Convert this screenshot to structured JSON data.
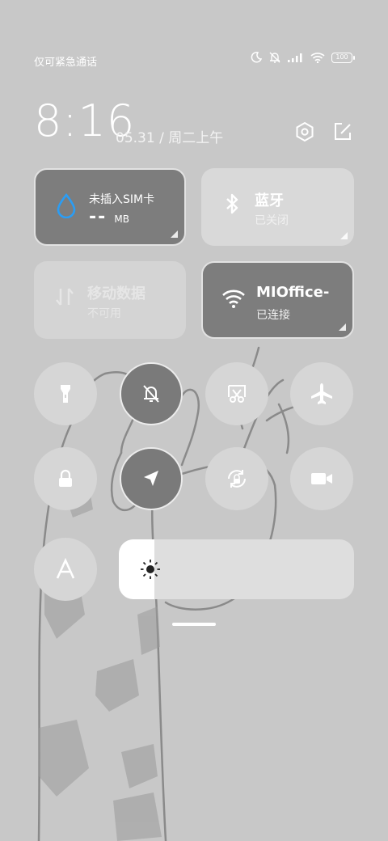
{
  "status_bar": {
    "left_text": "仅可紧急通话",
    "battery": "100",
    "icons": [
      "moon-icon",
      "silent-icon",
      "signal-icon",
      "wifi-icon",
      "battery-icon"
    ]
  },
  "header": {
    "time": "8:16",
    "date": "05.31 / 周二上午",
    "icons": [
      "settings-icon",
      "edit-icon"
    ]
  },
  "tiles": [
    {
      "id": "sim",
      "icon": "water-drop-icon",
      "title": "未插入SIM卡",
      "value": "--",
      "unit": "MB",
      "state": "active"
    },
    {
      "id": "bluetooth",
      "icon": "bluetooth-icon",
      "title": "蓝牙",
      "sub": "已关闭",
      "state": "off"
    },
    {
      "id": "mobile-data",
      "icon": "data-arrows-icon",
      "title": "移动数据",
      "sub": "不可用",
      "state": "disabled"
    },
    {
      "id": "wifi",
      "icon": "wifi-icon",
      "title": "MIOffice-",
      "sub": "已连接",
      "state": "active"
    }
  ],
  "toggles": [
    {
      "icon": "flashlight-icon",
      "state": "off"
    },
    {
      "icon": "mute-bell-icon",
      "state": "on"
    },
    {
      "icon": "screenshot-icon",
      "state": "off"
    },
    {
      "icon": "airplane-icon",
      "state": "off"
    },
    {
      "icon": "lock-icon",
      "state": "off"
    },
    {
      "icon": "location-icon",
      "state": "on"
    },
    {
      "icon": "rotation-lock-icon",
      "state": "off"
    },
    {
      "icon": "video-camera-icon",
      "state": "off"
    },
    {
      "icon": "font-size-icon",
      "state": "off"
    }
  ],
  "brightness": {
    "level": 0.15,
    "icon": "sun-icon"
  },
  "colors": {
    "background": "#c8c8c8",
    "tile_active": "#7d7d7d",
    "tile_inactive": "#d9d9d9"
  }
}
